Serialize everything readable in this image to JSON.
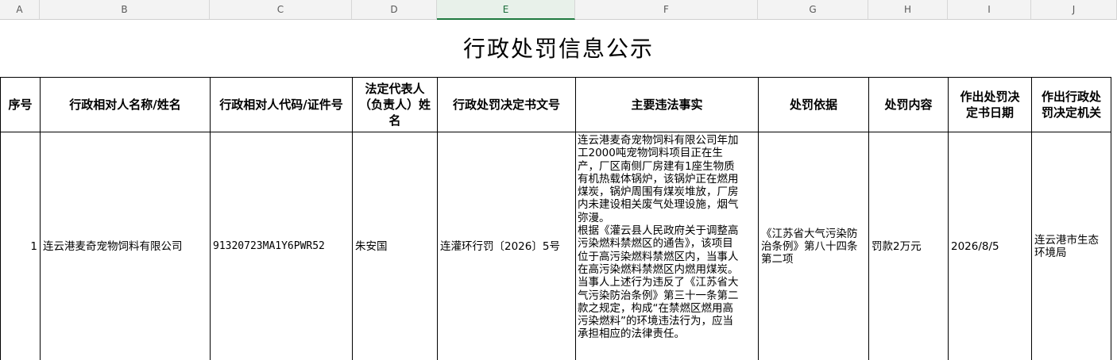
{
  "column_headers": [
    "A",
    "B",
    "C",
    "D",
    "E",
    "F",
    "G",
    "H",
    "I",
    "J"
  ],
  "active_column": "E",
  "title": "行政处罚信息公示",
  "table_headers": {
    "seq": "序号",
    "name": "行政相对人名称/姓名",
    "code": "行政相对人代码/证件号",
    "rep": "法定代表人（负责人）姓名",
    "doc": "行政处罚决定书文号",
    "facts": "主要违法事实",
    "basis": "处罚依据",
    "content": "处罚内容",
    "date": "作出处罚决定书日期",
    "org": "作出行政处罚决定机关"
  },
  "rows": [
    {
      "seq": "1",
      "name": "连云港麦奇宠物饲料有限公司",
      "code": "91320723MA1Y6PWR52",
      "rep": "朱安国",
      "doc": "连灌环行罚〔2026〕5号",
      "facts": "连云港麦奇宠物饲料有限公司年加\n工2000吨宠物饲料项目正在生\n产，厂区南侧厂房建有1座生物质\n有机热载体锅炉，该锅炉正在燃用\n煤炭，锅炉周围有煤炭堆放，厂房\n内未建设相关废气处理设施，烟气\n弥漫。\n根据《灌云县人民政府关于调整高\n污染燃料禁燃区的通告》，该项目\n位于高污染燃料禁燃区内，当事人\n在高污染燃料禁燃区内燃用煤炭。\n当事人上述行为违反了《江苏省大\n气污染防治条例》第三十一条第二\n款之规定，构成“在禁燃区燃用高\n污染燃料”的环境违法行为，应当\n承担相应的法律责任。",
      "basis": "《江苏省大气污染防治条例》第八十四条第二项",
      "content": "罚款2万元",
      "date": "2026/8/5",
      "org": "连云港市生态环境局"
    }
  ]
}
